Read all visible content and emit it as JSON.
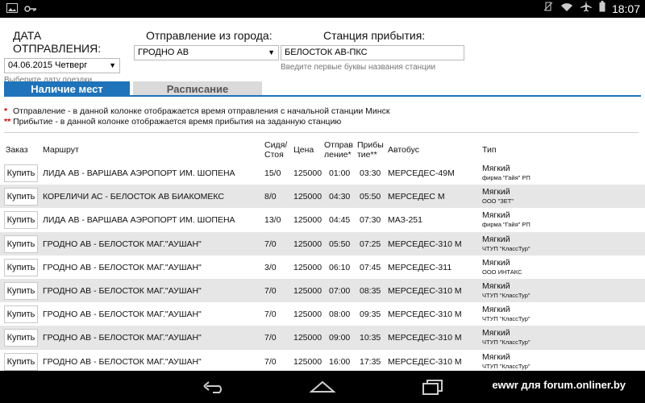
{
  "statusbar": {
    "time": "18:07"
  },
  "form": {
    "date_label": "ДАТА ОТПРАВЛЕНИЯ:",
    "date_value": "04.06.2015 Четверг",
    "date_hint": "Выберите дату поездки",
    "from_label": "Отправление из города:",
    "from_value": "ГРОДНО АВ",
    "to_label": "Станция прибытия:",
    "to_value": "БЕЛОСТОК АВ-ПКС",
    "to_hint": "Введите первые буквы названия станции"
  },
  "tabs": [
    {
      "label": "Наличие мест"
    },
    {
      "label": "Расписание"
    }
  ],
  "notes": [
    {
      "star": "*",
      "text": "Отправление - в данной колонке отображается время отправления с начальной станции Минск"
    },
    {
      "star": "**",
      "text": "Прибытие - в данной колонке отображается время прибытия на заданную станцию"
    }
  ],
  "table": {
    "headers": {
      "order": "Заказ",
      "route": "Маршрут",
      "seats_1": "Сидя/",
      "seats_2": "Стоя",
      "price": "Цена",
      "dep_1": "Отправ",
      "dep_2": "ление*",
      "arr_1": "Прибы",
      "arr_2": "тие**",
      "bus": "Автобус",
      "type": "Тип"
    },
    "buy_label": "Купить",
    "rows": [
      {
        "route": "ЛИДА АВ - ВАРШАВА АЭРОПОРТ ИМ. ШОПЕНА",
        "seats": "15/0",
        "price": "125000",
        "dep": "01:00",
        "arr": "03:30",
        "bus": "МЕРСЕДЕС-49М",
        "type": "Мягкий",
        "carrier": "фирма \"Гайя\" РП"
      },
      {
        "route": "КОРЕЛИЧИ АС - БЕЛОСТОК АВ БИАКОМЕКС",
        "seats": "8/0",
        "price": "125000",
        "dep": "04:30",
        "arr": "05:50",
        "bus": "МЕРСЕДЕС М",
        "type": "Мягкий",
        "carrier": "ООО \"ЗЕТ\""
      },
      {
        "route": "ЛИДА АВ - ВАРШАВА АЭРОПОРТ ИМ. ШОПЕНА",
        "seats": "13/0",
        "price": "125000",
        "dep": "04:45",
        "arr": "07:30",
        "bus": "МАЗ-251",
        "type": "Мягкий",
        "carrier": "фирма \"Гайя\" РП"
      },
      {
        "route": "ГРОДНО АВ - БЕЛОСТОК МАГ.\"АУШАН\"",
        "seats": "7/0",
        "price": "125000",
        "dep": "05:50",
        "arr": "07:25",
        "bus": "МЕРСЕДЕС-310 М",
        "type": "Мягкий",
        "carrier": "ЧТУП \"КлассТур\""
      },
      {
        "route": "ГРОДНО АВ - БЕЛОСТОК МАГ.\"АУШАН\"",
        "seats": "3/0",
        "price": "125000",
        "dep": "06:10",
        "arr": "07:45",
        "bus": "МЕРСЕДЕС-311",
        "type": "Мягкий",
        "carrier": "ООО ИНТАКС"
      },
      {
        "route": "ГРОДНО АВ - БЕЛОСТОК МАГ.\"АУШАН\"",
        "seats": "7/0",
        "price": "125000",
        "dep": "07:00",
        "arr": "08:35",
        "bus": "МЕРСЕДЕС-310 М",
        "type": "Мягкий",
        "carrier": "ЧТУП \"КлассТур\""
      },
      {
        "route": "ГРОДНО АВ - БЕЛОСТОК МАГ.\"АУШАН\"",
        "seats": "7/0",
        "price": "125000",
        "dep": "08:00",
        "arr": "09:35",
        "bus": "МЕРСЕДЕС-310 М",
        "type": "Мягкий",
        "carrier": "ЧТУП \"КлассТур\""
      },
      {
        "route": "ГРОДНО АВ - БЕЛОСТОК МАГ.\"АУШАН\"",
        "seats": "7/0",
        "price": "125000",
        "dep": "09:00",
        "arr": "10:35",
        "bus": "МЕРСЕДЕС-310 М",
        "type": "Мягкий",
        "carrier": "ЧТУП \"КлассТур\""
      },
      {
        "route": "ГРОДНО АВ - БЕЛОСТОК МАГ.\"АУШАН\"",
        "seats": "7/0",
        "price": "125000",
        "dep": "16:00",
        "arr": "17:35",
        "bus": "МЕРСЕДЕС-310 М",
        "type": "Мягкий",
        "carrier": "ЧТУП \"КлассТур\""
      }
    ]
  },
  "watermark": "ewwr для forum.onliner.by"
}
